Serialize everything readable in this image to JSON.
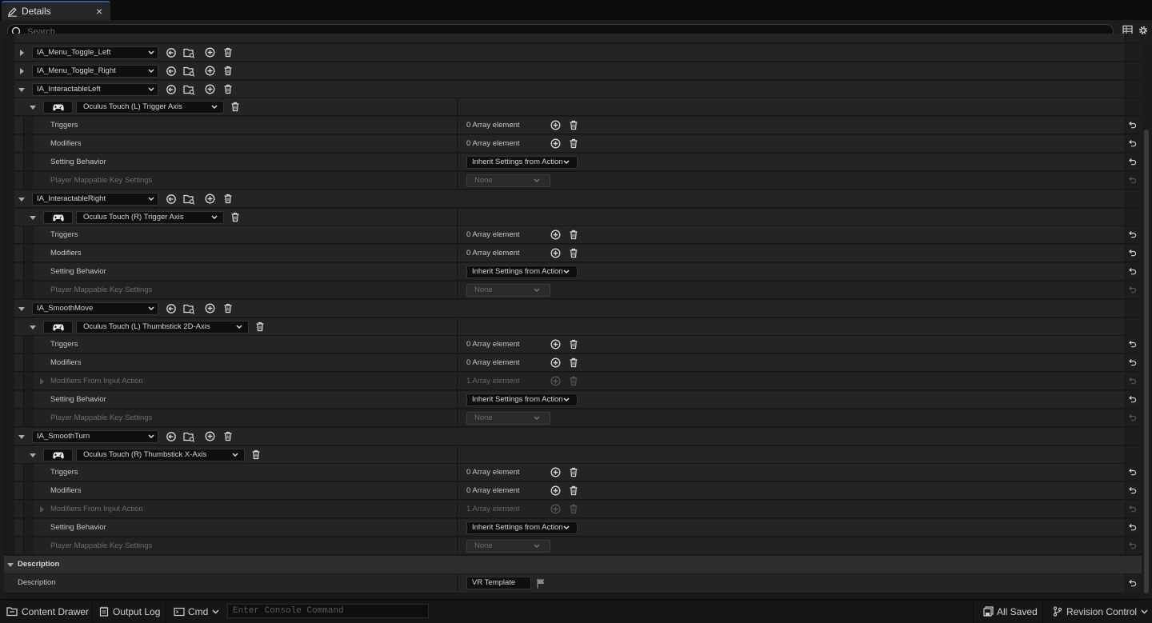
{
  "tab": {
    "title": "Details",
    "close": "×"
  },
  "search": {
    "placeholder": "Search"
  },
  "mappings": [
    {
      "action": "IA_Menu_Toggle_Left",
      "expanded": false
    },
    {
      "action": "IA_Menu_Toggle_Right",
      "expanded": false
    },
    {
      "action": "IA_InteractableLeft",
      "expanded": true,
      "key": "Oculus Touch (L) Trigger Axis",
      "props": [
        {
          "label": "Triggers",
          "value": "0 Array element",
          "kind": "array"
        },
        {
          "label": "Modifiers",
          "value": "0 Array element",
          "kind": "array"
        },
        {
          "label": "Setting Behavior",
          "value": "Inherit Settings from Action",
          "kind": "combo"
        },
        {
          "label": "Player Mappable Key Settings",
          "value": "None",
          "kind": "none"
        }
      ]
    },
    {
      "action": "IA_InteractableRight",
      "expanded": true,
      "key": "Oculus Touch (R) Trigger Axis",
      "props": [
        {
          "label": "Triggers",
          "value": "0 Array element",
          "kind": "array"
        },
        {
          "label": "Modifiers",
          "value": "0 Array element",
          "kind": "array"
        },
        {
          "label": "Setting Behavior",
          "value": "Inherit Settings from Action",
          "kind": "combo"
        },
        {
          "label": "Player Mappable Key Settings",
          "value": "None",
          "kind": "none"
        }
      ]
    },
    {
      "action": "IA_SmoothMove",
      "expanded": true,
      "key": "Oculus Touch (L) Thumbstick 2D-Axis",
      "props": [
        {
          "label": "Triggers",
          "value": "0 Array element",
          "kind": "array"
        },
        {
          "label": "Modifiers",
          "value": "0 Array element",
          "kind": "array"
        },
        {
          "label": "Modifiers From Input Action",
          "value": "1 Array element",
          "kind": "dimarray"
        },
        {
          "label": "Setting Behavior",
          "value": "Inherit Settings from Action",
          "kind": "combo"
        },
        {
          "label": "Player Mappable Key Settings",
          "value": "None",
          "kind": "none"
        }
      ]
    },
    {
      "action": "IA_SmoothTurn",
      "expanded": true,
      "key": "Oculus Touch (R) Thumbstick X-Axis",
      "props": [
        {
          "label": "Triggers",
          "value": "0 Array element",
          "kind": "array"
        },
        {
          "label": "Modifiers",
          "value": "0 Array element",
          "kind": "array"
        },
        {
          "label": "Modifiers From Input Action",
          "value": "1 Array element",
          "kind": "dimarray"
        },
        {
          "label": "Setting Behavior",
          "value": "Inherit Settings from Action",
          "kind": "combo"
        },
        {
          "label": "Player Mappable Key Settings",
          "value": "None",
          "kind": "none"
        }
      ]
    }
  ],
  "description_section": {
    "header": "Description",
    "label": "Description",
    "value": "VR Template"
  },
  "statusbar": {
    "content_drawer": "Content Drawer",
    "output_log": "Output Log",
    "cmd": "Cmd",
    "console_placeholder": "Enter Console Command",
    "all_saved": "All Saved",
    "revision_control": "Revision Control"
  }
}
